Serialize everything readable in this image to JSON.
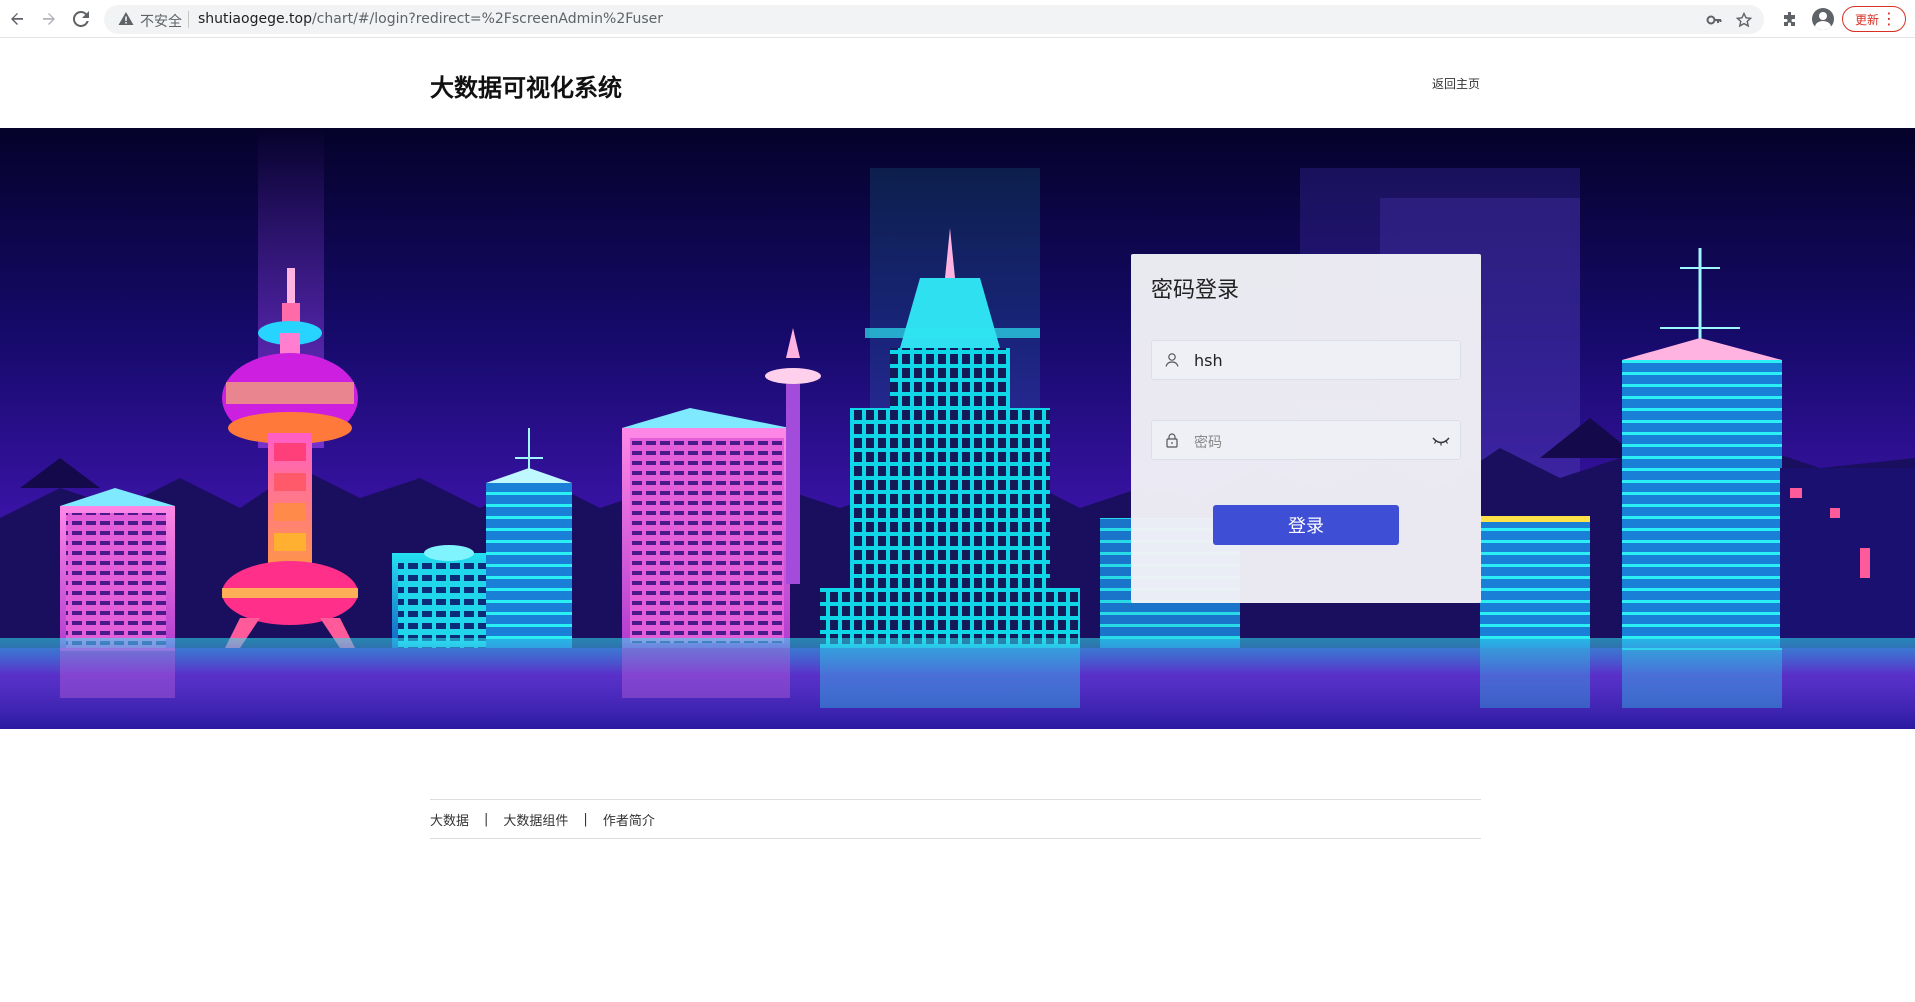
{
  "browser": {
    "security_label": "不安全",
    "url_host": "shutiaogege.top",
    "url_path": "/chart/#/login?redirect=%2FscreenAdmin%2Fuser",
    "update_label": "更新"
  },
  "header": {
    "title": "大数据可视化系统",
    "back_home": "返回主页"
  },
  "login": {
    "title": "密码登录",
    "username_value": "hsh",
    "password_placeholder": "密码",
    "submit_label": "登录",
    "primary_color": "#3e4fd6"
  },
  "footer": {
    "links": [
      "大数据",
      "大数据组件",
      "作者简介"
    ],
    "separator": "|"
  },
  "icons": {
    "back": "arrow-left-icon",
    "forward": "arrow-right-icon",
    "reload": "reload-icon",
    "warning": "warning-icon",
    "key": "key-icon",
    "star": "star-icon",
    "extensions": "puzzle-icon",
    "profile": "avatar-icon",
    "user": "user-icon",
    "lock": "lock-icon",
    "eye": "eye-closed-icon"
  }
}
